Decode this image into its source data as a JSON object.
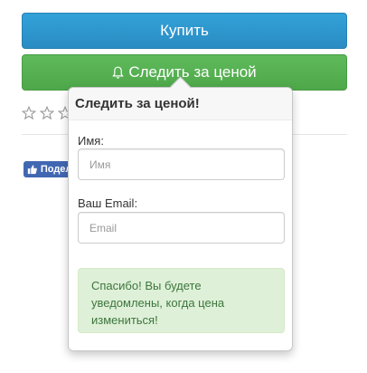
{
  "buy_button": {
    "label": "Купить",
    "color": "#2a8cc3"
  },
  "watch_button": {
    "label": "Следить за ценой",
    "icon": "bell-icon",
    "color": "#4ea84a"
  },
  "rating": {
    "stars_filled": 0,
    "stars_visible": 3
  },
  "facebook": {
    "label": "Подело",
    "icon": "thumbs-up-icon"
  },
  "popover": {
    "title": "Следить за ценой!",
    "name_label": "Имя:",
    "name_placeholder": "Имя",
    "email_label": "Ваш Email:",
    "email_placeholder": "Email",
    "success_message": "Спасибо! Вы будете уведомлены, когда цена измениться!"
  }
}
